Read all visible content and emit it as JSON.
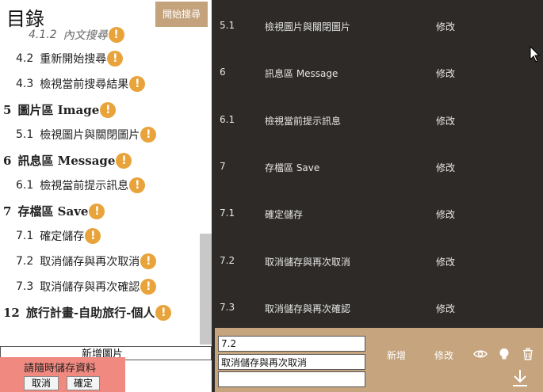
{
  "toc": {
    "title": "目錄",
    "search_button": "開始搜尋",
    "items": [
      {
        "num": "4.1.2",
        "label": "內文搜尋",
        "level": 3
      },
      {
        "num": "4.2",
        "label": "重新開始搜尋",
        "level": 2
      },
      {
        "num": "4.3",
        "label": "檢視當前搜尋結果",
        "level": 2
      },
      {
        "num": "5",
        "label": "圖片區 Image",
        "level": 1
      },
      {
        "num": "5.1",
        "label": "檢視圖片與關閉圖片",
        "level": 2
      },
      {
        "num": "6",
        "label": "訊息區 Message",
        "level": 1
      },
      {
        "num": "6.1",
        "label": "檢視當前提示訊息",
        "level": 2
      },
      {
        "num": "7",
        "label": "存檔區 Save",
        "level": 1
      },
      {
        "num": "7.1",
        "label": "確定儲存",
        "level": 2
      },
      {
        "num": "7.2",
        "label": "取消儲存與再次取消",
        "level": 2
      },
      {
        "num": "7.3",
        "label": "取消儲存與再次確認",
        "level": 2
      },
      {
        "num": "12",
        "label": "旅行計畫-自助旅行-個人",
        "level": 1
      }
    ],
    "warn_glyph": "!"
  },
  "image_button": "新增圖片",
  "save_popup": {
    "message": "請隨時儲存資料",
    "cancel": "取消",
    "ok": "確定"
  },
  "table": {
    "rows": [
      {
        "num": "5.1",
        "title": "檢視圖片與關閉圖片",
        "action": "修改"
      },
      {
        "num": "6",
        "title": "訊息區 Message",
        "action": "修改"
      },
      {
        "num": "6.1",
        "title": "檢視當前提示訊息",
        "action": "修改"
      },
      {
        "num": "7",
        "title": "存檔區 Save",
        "action": "修改"
      },
      {
        "num": "7.1",
        "title": "確定儲存",
        "action": "修改"
      },
      {
        "num": "7.2",
        "title": "取消儲存與再次取消",
        "action": "修改"
      },
      {
        "num": "7.3",
        "title": "取消儲存與再次確認",
        "action": "修改"
      }
    ]
  },
  "editor": {
    "num_value": "7.2",
    "title_value": "取消儲存與再次取消",
    "extra_value": "",
    "add_label": "新增",
    "edit_label": "修改"
  },
  "colors": {
    "accent": "#c4a27c",
    "warn": "#e8a33a",
    "table_bg": "#2d2a27",
    "popup_bg": "#f08a80"
  },
  "icons": [
    "eye-icon",
    "bulb-icon",
    "trash-icon",
    "download-icon",
    "warning-icon",
    "cursor-icon"
  ]
}
